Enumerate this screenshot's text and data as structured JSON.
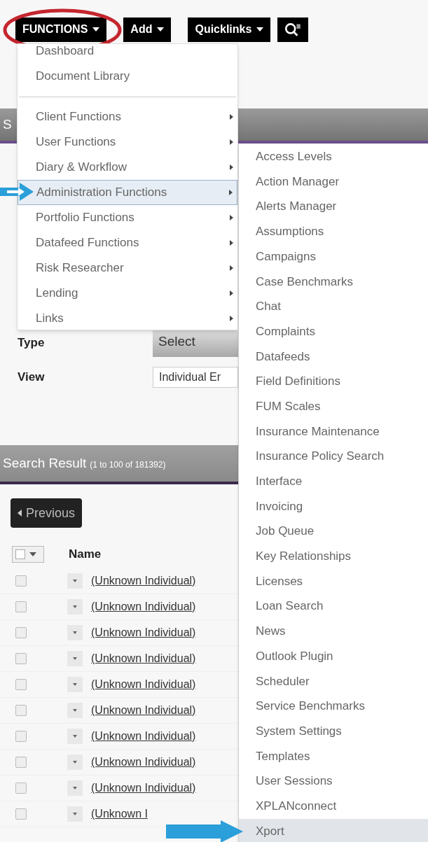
{
  "toolbar": {
    "buttons": [
      {
        "kind": "menu",
        "label": "FUNCTIONS",
        "highlighted": true
      },
      {
        "kind": "menu",
        "label": "Add",
        "highlighted": false
      },
      {
        "kind": "menu",
        "label": "Quicklinks",
        "highlighted": false
      },
      {
        "kind": "search",
        "highlighted": false
      }
    ]
  },
  "section_header": {
    "title": "S"
  },
  "filters": [
    {
      "kind": "select",
      "label": "Type",
      "value": "Select"
    },
    {
      "kind": "input",
      "label": "View",
      "value": "Individual Er"
    }
  ],
  "search_result": {
    "title": "Search Result",
    "count": "(1 to 100 of 181392)",
    "previous": "Previous",
    "columns": [
      "Name"
    ],
    "rows": [
      {
        "name": "(Unknown Individual)",
        "checked": false
      },
      {
        "name": "(Unknown Individual)",
        "checked": false
      },
      {
        "name": "(Unknown Individual)",
        "checked": false
      },
      {
        "name": "(Unknown Individual)",
        "checked": false
      },
      {
        "name": "(Unknown Individual)",
        "checked": false
      },
      {
        "name": "(Unknown Individual)",
        "checked": false
      },
      {
        "name": "(Unknown Individual)",
        "checked": false
      },
      {
        "name": "(Unknown Individual)",
        "checked": false
      },
      {
        "name": "(Unknown Individual)",
        "checked": false
      },
      {
        "name": "(Unknown I",
        "checked": false
      }
    ]
  },
  "functions_menu": {
    "items": [
      {
        "kind": "item",
        "label": "Dashboard",
        "submenu": false,
        "selected": false
      },
      {
        "kind": "item",
        "label": "Document Library",
        "submenu": false,
        "selected": false
      },
      {
        "kind": "separator"
      },
      {
        "kind": "item",
        "label": "Client Functions",
        "submenu": true,
        "selected": false
      },
      {
        "kind": "item",
        "label": "User Functions",
        "submenu": true,
        "selected": false
      },
      {
        "kind": "item",
        "label": "Diary & Workflow",
        "submenu": true,
        "selected": false
      },
      {
        "kind": "item",
        "label": "Administration Functions",
        "submenu": true,
        "selected": true
      },
      {
        "kind": "item",
        "label": "Portfolio Functions",
        "submenu": true,
        "selected": false
      },
      {
        "kind": "item",
        "label": "Datafeed Functions",
        "submenu": true,
        "selected": false
      },
      {
        "kind": "item",
        "label": "Risk Researcher",
        "submenu": true,
        "selected": false
      },
      {
        "kind": "item",
        "label": "Lending",
        "submenu": true,
        "selected": false
      },
      {
        "kind": "item",
        "label": "Links",
        "submenu": true,
        "selected": false
      }
    ]
  },
  "admin_submenu": {
    "items": [
      {
        "label": "Access Levels",
        "selected": false
      },
      {
        "label": "Action Manager",
        "selected": false
      },
      {
        "label": "Alerts Manager",
        "selected": false
      },
      {
        "label": "Assumptions",
        "selected": false
      },
      {
        "label": "Campaigns",
        "selected": false
      },
      {
        "label": "Case Benchmarks",
        "selected": false
      },
      {
        "label": "Chat",
        "selected": false
      },
      {
        "label": "Complaints",
        "selected": false
      },
      {
        "label": "Datafeeds",
        "selected": false
      },
      {
        "label": "Field Definitions",
        "selected": false
      },
      {
        "label": "FUM Scales",
        "selected": false
      },
      {
        "label": "Insurance Maintenance",
        "selected": false
      },
      {
        "label": "Insurance Policy Search",
        "selected": false
      },
      {
        "label": "Interface",
        "selected": false
      },
      {
        "label": "Invoicing",
        "selected": false
      },
      {
        "label": "Job Queue",
        "selected": false
      },
      {
        "label": "Key Relationships",
        "selected": false
      },
      {
        "label": "Licenses",
        "selected": false
      },
      {
        "label": "Loan Search",
        "selected": false
      },
      {
        "label": "News",
        "selected": false
      },
      {
        "label": "Outlook Plugin",
        "selected": false
      },
      {
        "label": "Scheduler",
        "selected": false
      },
      {
        "label": "Service Benchmarks",
        "selected": false
      },
      {
        "label": "System Settings",
        "selected": false
      },
      {
        "label": "Templates",
        "selected": false
      },
      {
        "label": "User Sessions",
        "selected": false
      },
      {
        "label": "XPLANconnect",
        "selected": false
      },
      {
        "label": "Xport",
        "selected": true
      }
    ]
  }
}
